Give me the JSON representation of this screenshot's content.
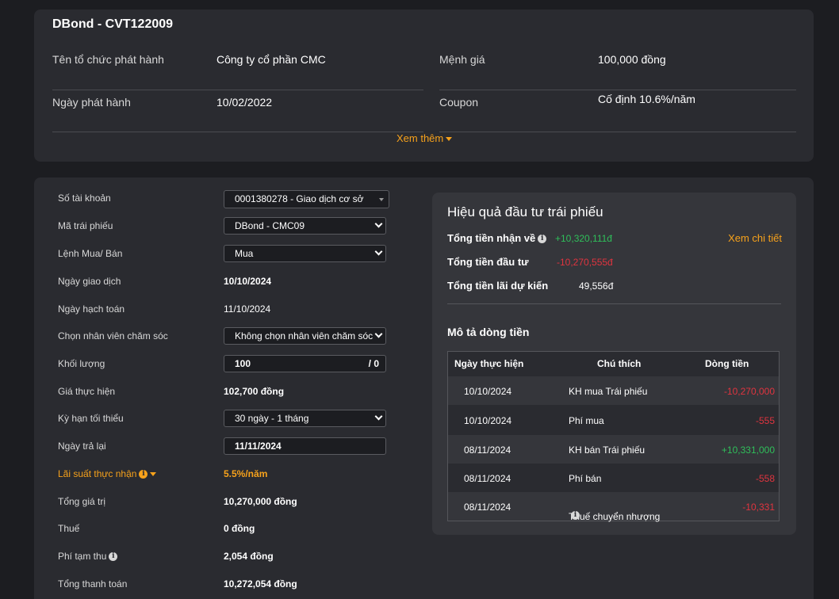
{
  "bond_info": {
    "title": "DBond - CVT122009",
    "issuer_label": "Tên tổ chức phát hành",
    "issuer_value": "Công ty cổ phần CMC",
    "face_value_label": "Mệnh giá",
    "face_value_value": "100,000 đồng",
    "issue_date_label": "Ngày phát hành",
    "issue_date_value": "10/02/2022",
    "coupon_label": "Coupon",
    "coupon_value": "Cố định 10.6%/năm",
    "see_more": "Xem thêm"
  },
  "form": {
    "account": {
      "label": "Số tài khoản",
      "value": "0001380278 - Giao dịch cơ sở"
    },
    "bond_code": {
      "label": "Mã trái phiếu",
      "value": "DBond - CMC09"
    },
    "order_type": {
      "label": "Lệnh Mua/ Bán",
      "value": "Mua"
    },
    "trade_date": {
      "label": "Ngày giao dịch",
      "value": "10/10/2024"
    },
    "accounting_date": {
      "label": "Ngày hạch toán",
      "value": "11/10/2024"
    },
    "staff": {
      "label": "Chọn nhân viên chăm sóc",
      "value": "Không chọn nhân viên chăm sóc"
    },
    "quantity": {
      "label": "Khối lượng",
      "value": "100",
      "max": "/ 0"
    },
    "price": {
      "label": "Giá thực hiện",
      "value": "102,700 đồng"
    },
    "min_term": {
      "label": "Kỳ hạn tối thiểu",
      "value": "30 ngày - 1 tháng"
    },
    "return_date": {
      "label": "Ngày trả lại",
      "value": "11/11/2024"
    },
    "rate": {
      "label": "Lãi suất thực nhận",
      "value": "5.5%/năm"
    },
    "total_value": {
      "label": "Tổng giá trị",
      "value": "10,270,000 đồng"
    },
    "tax": {
      "label": "Thuế",
      "value": "0 đồng"
    },
    "temp_fee": {
      "label": "Phí tạm thu",
      "value": "2,054 đồng"
    },
    "total_payment": {
      "label": "Tổng thanh toán",
      "value": "10,272,054 đồng"
    }
  },
  "performance": {
    "title": "Hiệu quả đầu tư trái phiếu",
    "received_label": "Tổng tiền nhận về",
    "received_value": "+10,320,111đ",
    "invested_label": "Tổng tiền đầu tư",
    "invested_value": "-10,270,555đ",
    "interest_label": "Tổng tiền lãi dự kiến",
    "interest_value": "49,556đ",
    "see_detail": "Xem chi tiết",
    "colors": {
      "positive": "#2fbf5a",
      "negative": "#e0343f",
      "accent": "#f7a21b"
    }
  },
  "cashflow": {
    "title": "Mô tả dòng tiền",
    "headers": [
      "Ngày thực hiện",
      "Chú thích",
      "Dòng tiền"
    ],
    "rows": [
      {
        "date": "10/10/2024",
        "note": "KH mua Trái phiếu",
        "amount": "-10,270,000"
      },
      {
        "date": "10/10/2024",
        "note": "Phí mua",
        "amount": "-555"
      },
      {
        "date": "08/11/2024",
        "note": "KH bán Trái phiếu",
        "amount": "+10,331,000"
      },
      {
        "date": "08/11/2024",
        "note": "Phí bán",
        "amount": "-558"
      },
      {
        "date": "08/11/2024",
        "note": "Thuế chuyển nhượng",
        "amount": "-10,331"
      }
    ]
  }
}
